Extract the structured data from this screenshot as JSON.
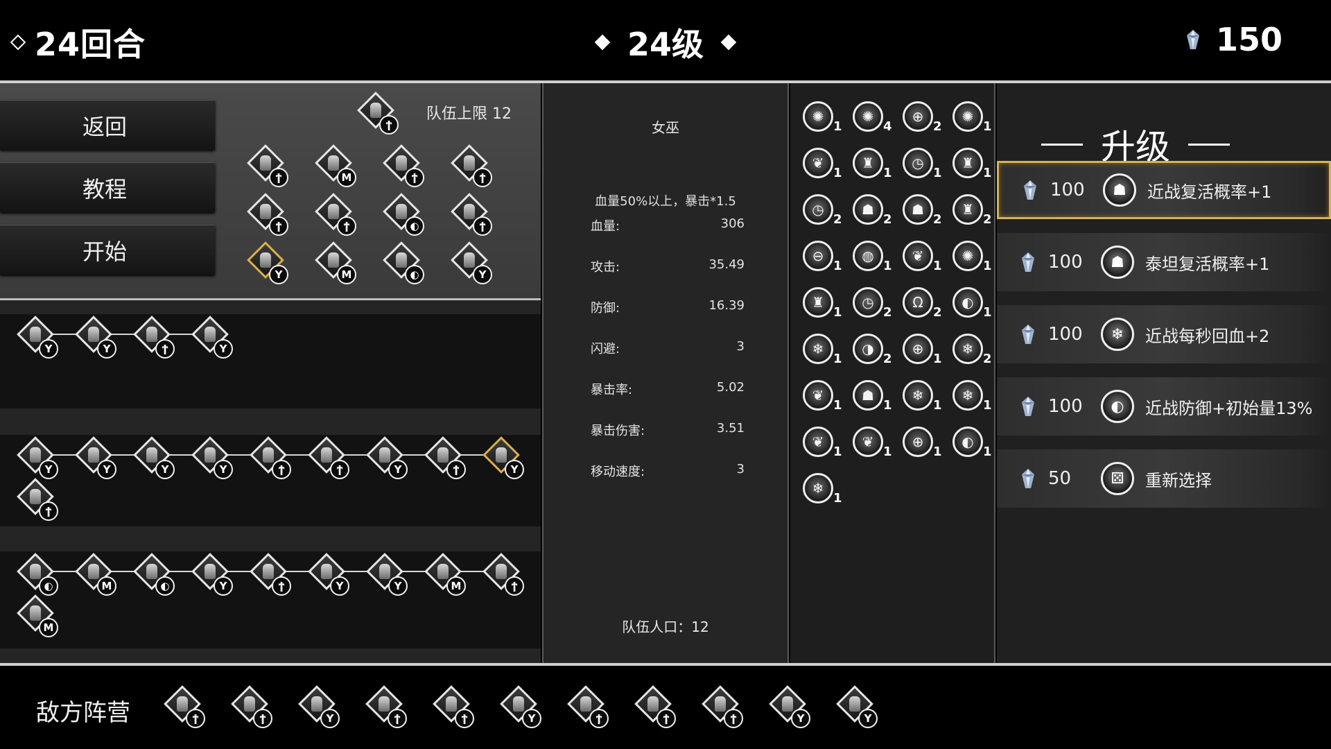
{
  "header": {
    "round_label": "24回合",
    "level_label": "24级",
    "gold": "150"
  },
  "menu": {
    "back": "返回",
    "tutorial": "教程",
    "start": "开始",
    "team_limit": "队伍上限 12"
  },
  "recruit_pool": [
    {
      "badge": "ϯ"
    },
    {
      "badge": "ϯ"
    },
    {
      "badge": "M"
    },
    {
      "badge": "ϯ"
    },
    {
      "badge": "ϯ"
    },
    {
      "badge": "ϯ"
    },
    {
      "badge": "ϯ"
    },
    {
      "badge": "◐"
    },
    {
      "badge": "ϯ"
    },
    {
      "badge": "Y",
      "gold": true
    },
    {
      "badge": "M"
    },
    {
      "badge": "◐"
    },
    {
      "badge": "Y"
    }
  ],
  "team_rows": [
    {
      "units": [
        {
          "badge": "Y"
        },
        {
          "badge": "Y"
        },
        {
          "badge": "ϯ"
        },
        {
          "badge": "Y"
        }
      ]
    },
    {
      "units": [
        {
          "badge": "Y"
        },
        {
          "badge": "Y"
        },
        {
          "badge": "Y"
        },
        {
          "badge": "Y"
        },
        {
          "badge": "ϯ"
        },
        {
          "badge": "ϯ"
        },
        {
          "badge": "Y"
        },
        {
          "badge": "ϯ"
        },
        {
          "badge": "Y",
          "gold": true
        },
        {
          "badge": "ϯ"
        }
      ]
    },
    {
      "units": [
        {
          "badge": "◐"
        },
        {
          "badge": "M"
        },
        {
          "badge": "◐"
        },
        {
          "badge": "Y"
        },
        {
          "badge": "ϯ"
        },
        {
          "badge": "Y"
        },
        {
          "badge": "Y"
        },
        {
          "badge": "M"
        },
        {
          "badge": "ϯ"
        },
        {
          "badge": "M"
        }
      ]
    }
  ],
  "unit_detail": {
    "name": "女巫",
    "passive": "血量50%以上，暴击*1.5",
    "stats": [
      {
        "label": "血量:",
        "value": "306"
      },
      {
        "label": "攻击:",
        "value": "35.49"
      },
      {
        "label": "防御:",
        "value": "16.39"
      },
      {
        "label": "闪避:",
        "value": "3"
      },
      {
        "label": "暴击率:",
        "value": "5.02"
      },
      {
        "label": "暴击伤害:",
        "value": "3.51"
      },
      {
        "label": "移动速度:",
        "value": "3"
      }
    ],
    "population": "队伍人口：12"
  },
  "buffs": [
    {
      "icon": "sun-icon",
      "glyph": "✺",
      "count": "1"
    },
    {
      "icon": "sun-icon",
      "glyph": "✺",
      "count": "4"
    },
    {
      "icon": "shield-icon",
      "glyph": "⊕",
      "count": "2"
    },
    {
      "icon": "sun-icon",
      "glyph": "✺",
      "count": "1"
    },
    {
      "icon": "wheat-icon",
      "glyph": "❦",
      "count": "1"
    },
    {
      "icon": "tower-icon",
      "glyph": "♜",
      "count": "1"
    },
    {
      "icon": "clock-icon",
      "glyph": "◷",
      "count": "1"
    },
    {
      "icon": "tower-icon",
      "glyph": "♜",
      "count": "1"
    },
    {
      "icon": "clock-icon",
      "glyph": "◷",
      "count": "2"
    },
    {
      "icon": "helmet-icon",
      "glyph": "☗",
      "count": "2"
    },
    {
      "icon": "helmet-icon",
      "glyph": "☗",
      "count": "2"
    },
    {
      "icon": "tower-icon",
      "glyph": "♜",
      "count": "2"
    },
    {
      "icon": "shield-icon",
      "glyph": "⊖",
      "count": "1"
    },
    {
      "icon": "shield-icon",
      "glyph": "◍",
      "count": "1"
    },
    {
      "icon": "wheat-icon",
      "glyph": "❦",
      "count": "1"
    },
    {
      "icon": "sun-icon",
      "glyph": "✺",
      "count": "1"
    },
    {
      "icon": "tower-icon",
      "glyph": "♜",
      "count": "1"
    },
    {
      "icon": "clock-icon",
      "glyph": "◷",
      "count": "2"
    },
    {
      "icon": "omega-icon",
      "glyph": "Ω",
      "count": "2"
    },
    {
      "icon": "shield-icon",
      "glyph": "◐",
      "count": "1"
    },
    {
      "icon": "snowflake-icon",
      "glyph": "❄",
      "count": "1"
    },
    {
      "icon": "shield-icon",
      "glyph": "◑",
      "count": "2"
    },
    {
      "icon": "shield-icon",
      "glyph": "⊕",
      "count": "1"
    },
    {
      "icon": "snowflake-icon",
      "glyph": "❄",
      "count": "2"
    },
    {
      "icon": "wheat-icon",
      "glyph": "❦",
      "count": "1"
    },
    {
      "icon": "helmet-icon",
      "glyph": "☗",
      "count": "1"
    },
    {
      "icon": "snowflake-icon",
      "glyph": "❄",
      "count": "1"
    },
    {
      "icon": "snowflake-icon",
      "glyph": "❄",
      "count": "1"
    },
    {
      "icon": "wheat-icon",
      "glyph": "❦",
      "count": "1"
    },
    {
      "icon": "wheat-icon",
      "glyph": "❦",
      "count": "1"
    },
    {
      "icon": "shield-icon",
      "glyph": "⊕",
      "count": "1"
    },
    {
      "icon": "shield-icon",
      "glyph": "◐",
      "count": "1"
    },
    {
      "icon": "snowflake-icon",
      "glyph": "❄",
      "count": "1"
    }
  ],
  "upgrade": {
    "title": "升级",
    "options": [
      {
        "cost": "100",
        "icon": "helmet-icon",
        "glyph": "☗",
        "label": "近战复活概率+1",
        "selected": true
      },
      {
        "cost": "100",
        "icon": "helmet-icon",
        "glyph": "☗",
        "label": "泰坦复活概率+1"
      },
      {
        "cost": "100",
        "icon": "snowflake-icon",
        "glyph": "❄",
        "label": "近战每秒回血+2"
      },
      {
        "cost": "100",
        "icon": "shield-icon",
        "glyph": "◐",
        "label": "近战防御+初始量13%"
      },
      {
        "cost": "50",
        "icon": "dice-icon",
        "glyph": "⚄",
        "label": "重新选择"
      }
    ]
  },
  "enemy": {
    "label": "敌方阵营",
    "units": [
      {
        "badge": "ϯ"
      },
      {
        "badge": "ϯ"
      },
      {
        "badge": "Y"
      },
      {
        "badge": "ϯ"
      },
      {
        "badge": "ϯ"
      },
      {
        "badge": "Y"
      },
      {
        "badge": "ϯ"
      },
      {
        "badge": "ϯ"
      },
      {
        "badge": "ϯ"
      },
      {
        "badge": "Y"
      },
      {
        "badge": "Y"
      }
    ]
  }
}
